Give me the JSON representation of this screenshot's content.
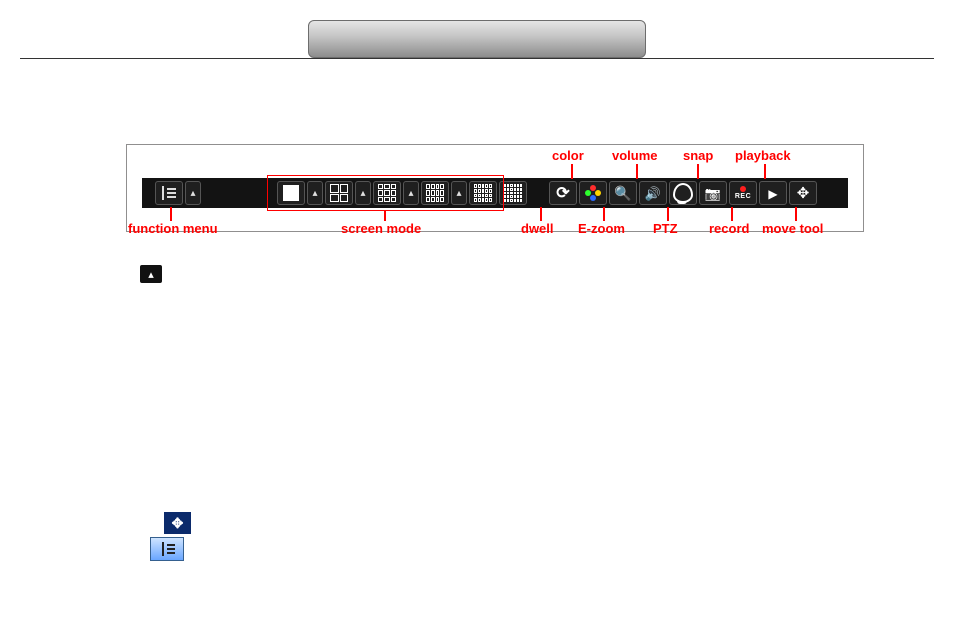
{
  "labels": {
    "function_menu": "function menu",
    "screen_mode": "screen mode",
    "dwell": "dwell",
    "color": "color",
    "ezoom": "E-zoom",
    "volume": "volume",
    "ptz": "PTZ",
    "snap": "snap",
    "record": "record",
    "playback": "playback",
    "move_tool": "move tool"
  },
  "rec_text": "REC"
}
